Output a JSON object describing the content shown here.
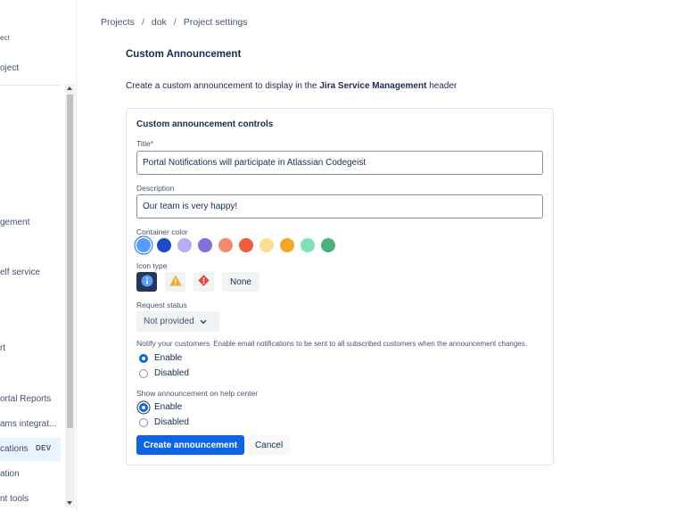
{
  "sidebar": {
    "items": [
      {
        "label": "ect"
      },
      {
        "label": "oject"
      },
      {
        "label": "gement"
      },
      {
        "label": "elf service"
      },
      {
        "label": "rt"
      },
      {
        "label": "ortal Reports"
      },
      {
        "label": "ams integrat..."
      },
      {
        "label": "cations"
      },
      {
        "label": "ation"
      },
      {
        "label": "nt tools"
      }
    ],
    "active_badge": "DEV"
  },
  "breadcrumb": {
    "items": [
      "Projects",
      "dok",
      "Project settings"
    ],
    "separator": "/"
  },
  "page": {
    "title": "Custom Announcement",
    "intro_prefix": "Create a custom announcement to display in the ",
    "intro_bold": "Jira Service Management",
    "intro_suffix": " header"
  },
  "form": {
    "card_title": "Custom announcement controls",
    "title_label": "Title",
    "required_marker": "*",
    "title_value": "Portal Notifications will participate in Atlassian Codegeist",
    "description_label": "Description",
    "description_value": "Our team is very happy!",
    "container_color_label": "Container color",
    "colors": [
      "#579dff",
      "#1d4bc9",
      "#b8acf6",
      "#8270db",
      "#f38a6f",
      "#f15b3e",
      "#f8e08e",
      "#f5a623",
      "#7ee2b8",
      "#4bb37a"
    ],
    "selected_color_index": 0,
    "icon_type_label": "Icon type",
    "icon_types": [
      {
        "name": "info-icon",
        "selected": true
      },
      {
        "name": "warning-icon",
        "selected": false
      },
      {
        "name": "error-icon",
        "selected": false
      }
    ],
    "icon_none_label": "None",
    "request_status_label": "Request status",
    "request_status_value": "Not provided",
    "notify_label": "Notify your customers",
    "notify_hint": "Enable email notifications to be sent to all subscribed customers when the announcement changes.",
    "notify_options": [
      {
        "label": "Enable",
        "checked": true
      },
      {
        "label": "Disabled",
        "checked": false
      }
    ],
    "show_label": "Show announcement on help center",
    "show_options": [
      {
        "label": "Enable",
        "checked": true
      },
      {
        "label": "Disabled",
        "checked": false
      }
    ],
    "create_button": "Create announcement",
    "cancel_button": "Cancel"
  }
}
